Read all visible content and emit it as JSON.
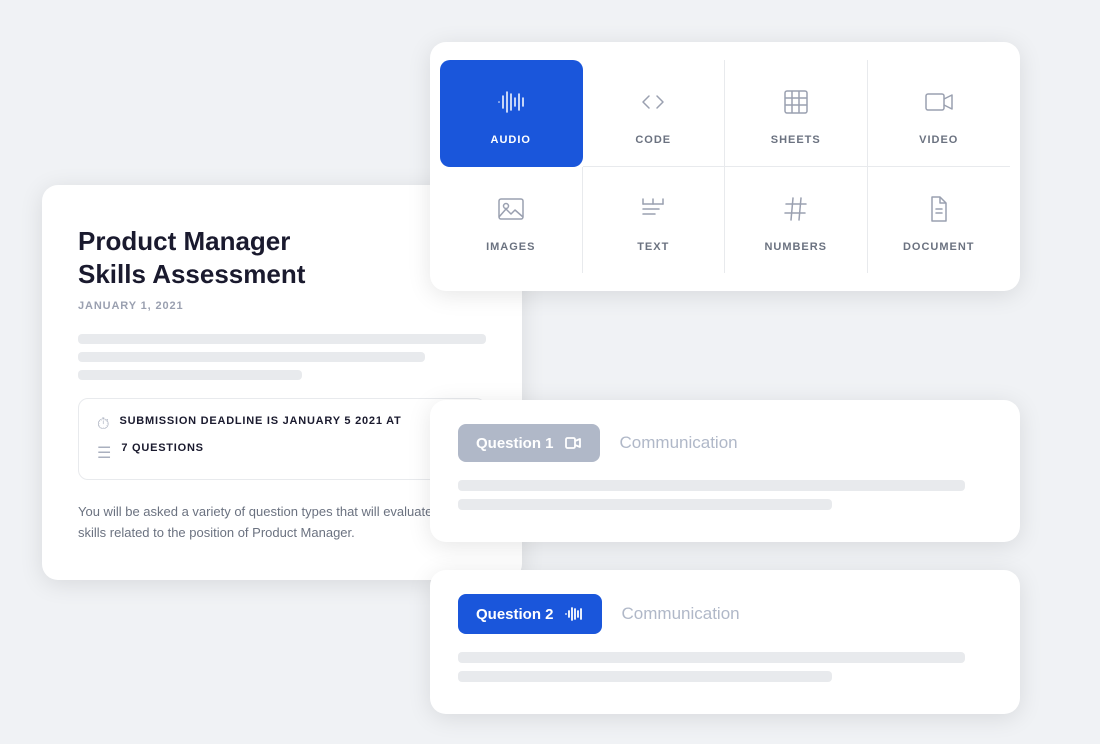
{
  "assessment": {
    "title": "Product Manager\nSkills Assessment",
    "date": "January 1, 2021",
    "deadline_label": "SUBMISSION DEADLINE IS JANUARY 5 2021 AT",
    "questions_count_label": "7 QUESTIONS",
    "body_text": "You will be asked a variety of question types that will evaluate and skills related to the position of Product Manager."
  },
  "media_types": [
    {
      "id": "audio",
      "label": "AUDIO",
      "icon": "audio",
      "active": true
    },
    {
      "id": "code",
      "label": "CODE",
      "icon": "code",
      "active": false
    },
    {
      "id": "sheets",
      "label": "SHEETS",
      "icon": "sheets",
      "active": false
    },
    {
      "id": "video",
      "label": "VIDEO",
      "icon": "video",
      "active": false
    },
    {
      "id": "images",
      "label": "IMAGES",
      "icon": "images",
      "active": false
    },
    {
      "id": "text",
      "label": "TEXT",
      "icon": "text",
      "active": false
    },
    {
      "id": "numbers",
      "label": "NUMBERS",
      "icon": "numbers",
      "active": false
    },
    {
      "id": "document",
      "label": "DOCUMENT",
      "icon": "document",
      "active": false
    }
  ],
  "questions": [
    {
      "label": "Question 1",
      "icon": "video",
      "badge_style": "grey",
      "category": "Communication"
    },
    {
      "label": "Question 2",
      "icon": "audio",
      "badge_style": "blue",
      "category": "Communication"
    }
  ]
}
